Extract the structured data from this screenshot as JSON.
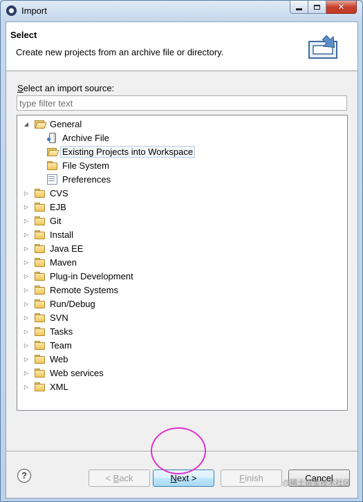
{
  "window": {
    "title": "Import",
    "min_icon": "minimize-icon",
    "max_icon": "maximize-icon",
    "close_icon": "close-icon",
    "close_glyph": "✕"
  },
  "header": {
    "title": "Select",
    "description": "Create new projects from an archive file or directory."
  },
  "source": {
    "label_accel": "S",
    "label_rest": "elect an import source:",
    "filter_placeholder": "type filter text"
  },
  "tree": {
    "items": [
      {
        "label": "General",
        "level": 0,
        "expanded": true,
        "icon": "folder-open-icon"
      },
      {
        "label": "Archive File",
        "level": 1,
        "icon": "archive-jar-icon"
      },
      {
        "label": "Existing Projects into Workspace",
        "level": 1,
        "icon": "open-folder-icon",
        "selected": true
      },
      {
        "label": "File System",
        "level": 1,
        "icon": "folder-icon"
      },
      {
        "label": "Preferences",
        "level": 1,
        "icon": "preferences-icon"
      },
      {
        "label": "CVS",
        "level": 0,
        "icon": "folder-icon"
      },
      {
        "label": "EJB",
        "level": 0,
        "icon": "folder-icon"
      },
      {
        "label": "Git",
        "level": 0,
        "icon": "folder-icon"
      },
      {
        "label": "Install",
        "level": 0,
        "icon": "folder-icon"
      },
      {
        "label": "Java EE",
        "level": 0,
        "icon": "folder-icon"
      },
      {
        "label": "Maven",
        "level": 0,
        "icon": "folder-icon"
      },
      {
        "label": "Plug-in Development",
        "level": 0,
        "icon": "folder-icon"
      },
      {
        "label": "Remote Systems",
        "level": 0,
        "icon": "folder-icon"
      },
      {
        "label": "Run/Debug",
        "level": 0,
        "icon": "folder-icon"
      },
      {
        "label": "SVN",
        "level": 0,
        "icon": "folder-icon"
      },
      {
        "label": "Tasks",
        "level": 0,
        "icon": "folder-icon"
      },
      {
        "label": "Team",
        "level": 0,
        "icon": "folder-icon"
      },
      {
        "label": "Web",
        "level": 0,
        "icon": "folder-icon"
      },
      {
        "label": "Web services",
        "level": 0,
        "icon": "folder-icon"
      },
      {
        "label": "XML",
        "level": 0,
        "icon": "folder-icon"
      }
    ]
  },
  "footer": {
    "help_label": "?",
    "back": {
      "pre": "< ",
      "accel": "B",
      "post": "ack"
    },
    "next": {
      "accel": "N",
      "post": "ext >"
    },
    "finish": {
      "accel": "F",
      "post": "inish"
    },
    "cancel_label": "Cancel"
  },
  "watermark": "@稀土掘金技术社区",
  "colors": {
    "annotation_circle": "#e22fd0",
    "titlebar": "#c5d8ec",
    "close_button": "#c7402d"
  }
}
